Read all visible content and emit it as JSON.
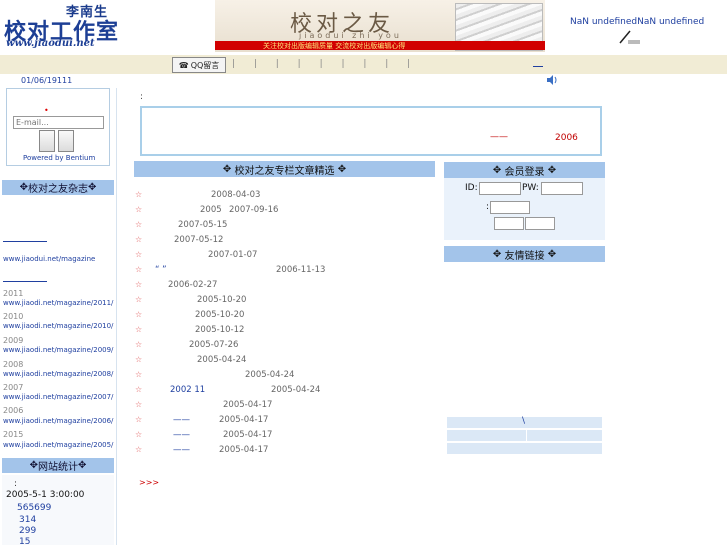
{
  "header": {
    "logo_author": "李南生",
    "logo_title": "校对工作室",
    "logo_url": "www.jiaodui.net",
    "banner_title": "校对之友",
    "banner_pinyin": "jiaodui  zhi  you",
    "banner_slogan": "关注校对出版编辑质量    交流校对出版编辑心得",
    "date_text": "NaN undefinedNaN  undefined"
  },
  "nav": {
    "qq_label": "QQ留言",
    "separators": "| | | | | | | | |"
  },
  "status": {
    "date": "01/06/19111"
  },
  "sidebar": {
    "email_placeholder": "E-mail...",
    "login_dot": "•",
    "powered": "Powered by Bentium",
    "magazine_head": "校对之友杂志",
    "magazine_main": "www.jiaodui.net/magazine",
    "years": [
      {
        "year": "2011",
        "url": "www.jiaodi.net/magazine/2011/"
      },
      {
        "year": "2010",
        "url": "www.jiaodi.net/magazine/2010/"
      },
      {
        "year": "2009",
        "url": "www.jiaodi.net/magazine/2009/"
      },
      {
        "year": "2008",
        "url": "www.jiaodi.net/magazine/2008/"
      },
      {
        "year": "2007",
        "url": "www.jiaodi.net/magazine/2007/"
      },
      {
        "year": "2006",
        "url": "www.jiaodi.net/magazine/2006/"
      },
      {
        "year": "2015",
        "url": "www.jiaodi.net/magazine/2005/"
      }
    ],
    "stats_head": "网站统计",
    "stats_colon": ":",
    "stats_start": "2005-5-1 3:00:00",
    "stats_values": [
      "565699",
      "314",
      "299",
      "15"
    ]
  },
  "notice": {
    "colon": ":",
    "dash": "——",
    "year": "2006"
  },
  "articles": {
    "head": "校对之友专栏文章精选",
    "items": [
      {
        "pre": "",
        "mid": "",
        "date": "2008-04-03"
      },
      {
        "pre": "",
        "mid": "2005",
        "date": "2007-09-16"
      },
      {
        "pre": "",
        "mid": "",
        "date": "2007-05-15"
      },
      {
        "pre": "",
        "mid": "",
        "date": "2007-05-12"
      },
      {
        "pre": "",
        "mid": "",
        "date": "2007-01-07"
      },
      {
        "pre": "“  ”",
        "mid": "",
        "date": "2006-11-13"
      },
      {
        "pre": "",
        "mid": "",
        "date": "2006-02-27"
      },
      {
        "pre": "",
        "mid": "",
        "date": "2005-10-20"
      },
      {
        "pre": "",
        "mid": "",
        "date": "2005-10-20"
      },
      {
        "pre": "",
        "mid": "",
        "date": "2005-10-12"
      },
      {
        "pre": "",
        "mid": "",
        "date": "2005-07-26"
      },
      {
        "pre": "",
        "mid": "",
        "date": "2005-04-24"
      },
      {
        "pre": "",
        "mid": "",
        "date": "2005-04-24"
      },
      {
        "pre": "2002 11",
        "mid": "",
        "date": "2005-04-24"
      },
      {
        "pre": "",
        "mid": "",
        "date": "2005-04-17"
      },
      {
        "pre": "——",
        "mid": "",
        "date": "2005-04-17"
      },
      {
        "pre": "——",
        "mid": "",
        "date": "2005-04-17"
      },
      {
        "pre": "——",
        "mid": "",
        "date": "2005-04-17"
      }
    ],
    "star": "☆",
    "more": ">>>"
  },
  "member": {
    "head": "会员登录",
    "id_label": "ID:",
    "pw_label": "PW:",
    "code_colon": ":"
  },
  "links": {
    "head": "友情链接",
    "backslash": "\\"
  }
}
